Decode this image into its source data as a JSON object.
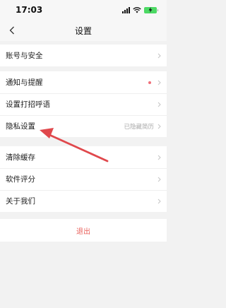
{
  "status_bar": {
    "time": "17:03"
  },
  "header": {
    "title": "设置"
  },
  "groups": [
    {
      "items": [
        {
          "label": "账号与安全"
        }
      ]
    },
    {
      "items": [
        {
          "label": "通知与提醒",
          "badge": true
        },
        {
          "label": "设置打招呼语"
        },
        {
          "label": "隐私设置",
          "value": "已隐藏简历"
        }
      ]
    },
    {
      "items": [
        {
          "label": "清除缓存"
        },
        {
          "label": "软件评分"
        },
        {
          "label": "关于我们"
        }
      ]
    }
  ],
  "logout": {
    "label": "退出"
  },
  "colors": {
    "accent": "#e9615c",
    "annotation_arrow": "#e0484c",
    "badge": "#f0707a"
  },
  "icons": {
    "back": "chevron-left-icon",
    "row": "chevron-right-icon"
  }
}
